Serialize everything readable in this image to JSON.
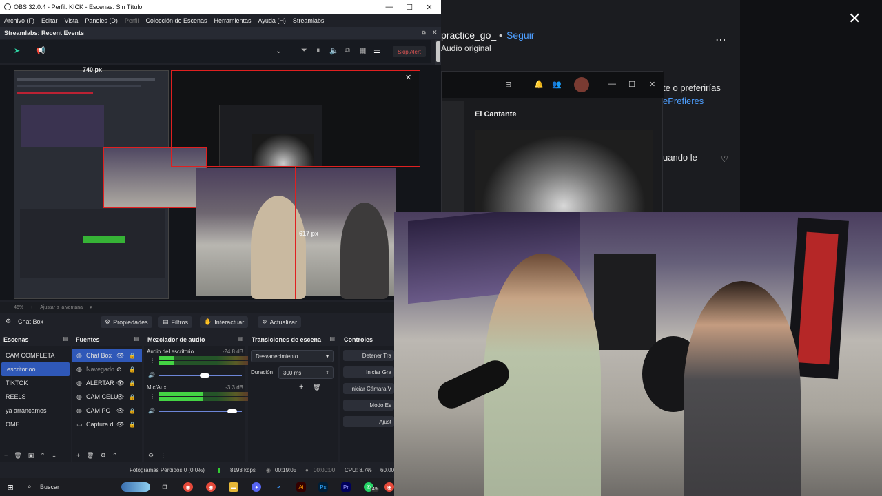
{
  "obs": {
    "title": "OBS 32.0.4 - Perfil: KICK - Escenas: Sin Título",
    "menu": [
      "Archivo (F)",
      "Editar",
      "Vista",
      "Paneles (D)",
      "Perfil",
      "Colección de Escenas",
      "Herramientas",
      "Ayuda (H)",
      "Streamlabs"
    ],
    "dock_title": "Streamlabs: Recent Events",
    "skip_alert": "Skip Alert",
    "preview": {
      "width_label": "740 px",
      "height_label": "617 px"
    },
    "zoom": {
      "value": "46%",
      "fit_label": "Ajustar a la ventana"
    },
    "source_bar": {
      "selected_source": "Chat Box",
      "buttons": [
        "Propiedades",
        "Filtros",
        "Interactuar",
        "Actualizar"
      ]
    },
    "scenes": {
      "title": "Escenas",
      "items": [
        "CAM COMPLETA",
        "escritorioo",
        "TIKTOK",
        "REELS",
        "ya arrancamos",
        "OME"
      ],
      "selected_index": 1
    },
    "sources": {
      "title": "Fuentes",
      "items": [
        {
          "name": "Chat Box",
          "icon": "globe-icon"
        },
        {
          "name": "Navegado",
          "icon": "globe-icon"
        },
        {
          "name": "ALERTAR",
          "icon": "globe-icon"
        },
        {
          "name": "CAM CELU",
          "icon": "camera-icon"
        },
        {
          "name": "CAM PC",
          "icon": "camera-icon"
        },
        {
          "name": "Captura d",
          "icon": "monitor-icon"
        }
      ],
      "selected_index": 0
    },
    "mixer": {
      "title": "Mezclador de audio",
      "channels": [
        {
          "name": "Audio del escritorio",
          "db": "-24.8 dB",
          "level": 0.18,
          "volume": 0.55
        },
        {
          "name": "Mic/Aux",
          "db": "-3.3 dB",
          "level": 0.52,
          "volume": 0.88
        }
      ],
      "scale": "-60-55-50-45-40-35-30-25-20-15-10-5 0"
    },
    "transitions": {
      "title": "Transiciones de escena",
      "type": "Desvanecimiento",
      "duration_label": "Duración",
      "duration": "300 ms"
    },
    "controls": {
      "title": "Controles",
      "buttons": [
        "Detener Tra",
        "Iniciar Gra",
        "Iniciar Cámara V",
        "Modo Es",
        "Ajust"
      ]
    },
    "status": {
      "dropped": "Fotogramas Perdidos 0 (0.0%)",
      "bitrate": "8193 kbps",
      "stream_time": "00:19:05",
      "rec_time": "00:00:00",
      "cpu": "CPU: 8.7%",
      "fps": "60.00"
    }
  },
  "taskbar": {
    "search_placeholder": "Buscar",
    "whatsapp_badge": "49"
  },
  "social": {
    "username": "practice_go_",
    "follow": "Seguir",
    "audio": "Audio original",
    "text1": "te o preferirías",
    "text2": "ePrefieres",
    "text3": "uando le",
    "inner_title": "El Cantante"
  },
  "colors": {
    "accent_blue": "#2f58b8",
    "red_selection": "#e02020",
    "skip_alert_red": "#e05555",
    "follow_blue": "#4e9fff"
  }
}
